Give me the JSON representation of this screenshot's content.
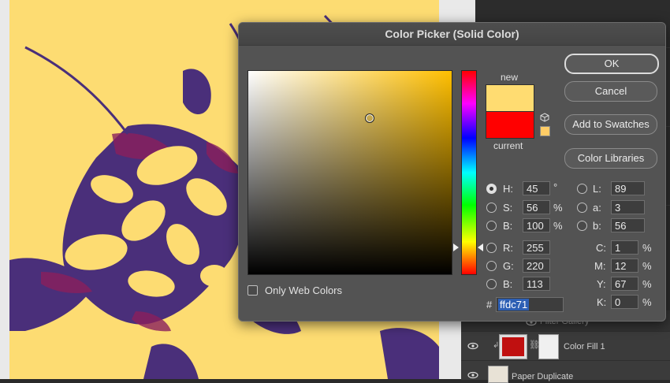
{
  "dialog": {
    "title": "Color Picker (Solid Color)",
    "new_label": "new",
    "current_label": "current",
    "new_color": "#ffdc71",
    "current_color": "#ff0000",
    "buttons": {
      "ok": "OK",
      "cancel": "Cancel",
      "add_to_swatches": "Add to Swatches",
      "color_libraries": "Color Libraries"
    },
    "only_web_colors": "Only Web Colors",
    "hsb": {
      "h_label": "H:",
      "h_value": "45",
      "h_unit": "°",
      "s_label": "S:",
      "s_value": "56",
      "s_unit": "%",
      "b_label": "B:",
      "b_value": "100",
      "b_unit": "%"
    },
    "rgb": {
      "r_label": "R:",
      "r_value": "255",
      "g_label": "G:",
      "g_value": "220",
      "b_label": "B:",
      "b_value": "113"
    },
    "lab": {
      "l_label": "L:",
      "l_value": "89",
      "a_label": "a:",
      "a_value": "3",
      "b_label": "b:",
      "b_value": "56"
    },
    "cmyk": {
      "c_label": "C:",
      "c_value": "1",
      "c_unit": "%",
      "m_label": "M:",
      "m_value": "12",
      "m_unit": "%",
      "y_label": "Y:",
      "y_value": "67",
      "y_unit": "%",
      "k_label": "K:",
      "k_value": "0",
      "k_unit": "%"
    },
    "hex_label": "#",
    "hex_value": "ffdc71",
    "selected_mode": "H"
  },
  "layers": {
    "filter_gallery": "Filter Gallery",
    "color_fill": "Color Fill 1",
    "paper_duplicate": "Paper Duplicate"
  },
  "colors": {
    "artwork_background": "#fddc72",
    "artwork_shadow": "#4a2f7a",
    "artwork_accent": "#8a1f5c",
    "fill_thumb": "#c01010"
  }
}
